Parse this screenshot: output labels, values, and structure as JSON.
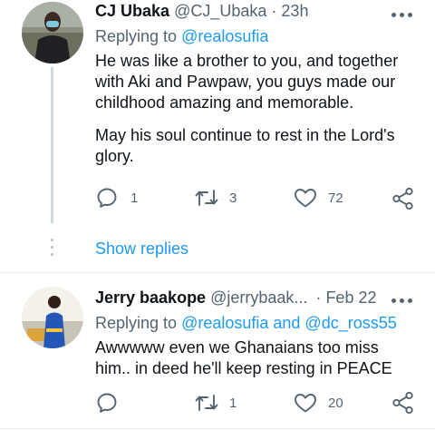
{
  "tweets": [
    {
      "name": "CJ Ubaka",
      "handle": "@CJ_Ubaka",
      "separator": "·",
      "time": "23h",
      "replying_label": "Replying to",
      "replying_to": "@realosufia",
      "paragraphs": [
        "He was like a brother to you, and together with Aki and Pawpaw, you guys made our childhood amazing and memorable.",
        "May his soul continue to rest in the Lord's glory."
      ],
      "replies": "1",
      "retweets": "3",
      "likes": "72"
    },
    {
      "name": "Jerry baakope",
      "handle": "@jerrybaak...",
      "separator": "·",
      "time": "Feb 22",
      "replying_label": "Replying to",
      "replying_to": "@realosufia and @dc_ross55",
      "paragraphs": [
        "Awwwww even we Ghanaians too miss him.. in deed he'll keep resting in PEACE"
      ],
      "replies": "",
      "retweets": "1",
      "likes": "20"
    }
  ],
  "show_replies_label": "Show replies",
  "icons": [
    "more-icon",
    "reply-icon",
    "retweet-icon",
    "like-icon",
    "share-icon"
  ],
  "colors": {
    "link": "#1d9bf0",
    "secondary_text": "#536471",
    "primary_text": "#0f1419"
  }
}
